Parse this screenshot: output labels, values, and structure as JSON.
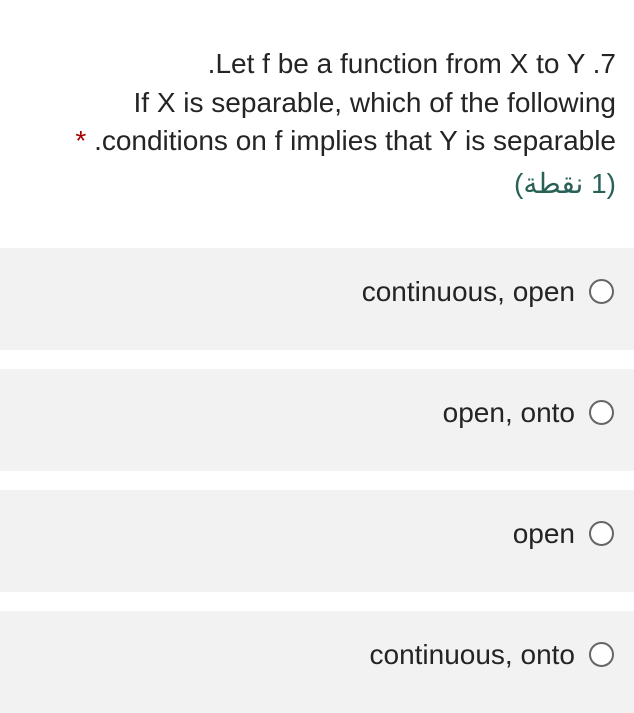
{
  "question": {
    "number": "7",
    "line1": ".Let f be a function from X to Y .7",
    "line2": "If X is separable, which of the following",
    "line3": ".conditions on f implies that Y is separable",
    "required": "*",
    "points": "(1 نقطة)"
  },
  "options": [
    {
      "label": "continuous, open"
    },
    {
      "label": "open, onto"
    },
    {
      "label": "open"
    },
    {
      "label": "continuous, onto"
    }
  ]
}
